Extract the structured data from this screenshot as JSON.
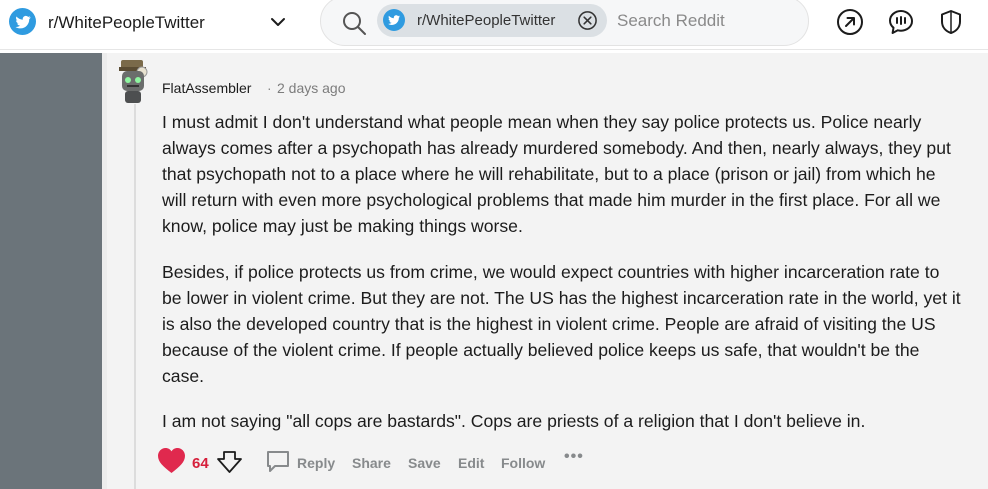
{
  "header": {
    "subreddit_name": "r/WhitePeopleTwitter",
    "subreddit_icon": "subreddit-bird-icon",
    "search_chip_label": "r/WhitePeopleTwitter",
    "search_placeholder": "Search Reddit"
  },
  "comment": {
    "author": "FlatAssembler",
    "separator": "·",
    "timestamp": "2 days ago",
    "paragraphs": [
      "I must admit I don't understand what people mean when they say police protects us. Police nearly always comes after a psychopath has already murdered somebody. And then, nearly always, they put that psychopath not to a place where he will rehabilitate, but to a place (prison or jail) from which he will return with even more psychological problems that made him murder in the first place. For all we know, police may just be making things worse.",
      "Besides, if police protects us from crime, we would expect countries with higher incarceration rate to be lower in violent crime. But they are not. The US has the highest incarceration rate in the world, yet it is also the developed country that is the highest in violent crime. People are afraid of visiting the US because of the violent crime. If people actually believed police keeps us safe, that wouldn't be the case.",
      "I am not saying \"all cops are bastards\". Cops are priests of a religion that I don't believe in."
    ],
    "score": "64",
    "actions": {
      "reply": "Reply",
      "share": "Share",
      "save": "Save",
      "edit": "Edit",
      "follow": "Follow",
      "more": "•••"
    }
  },
  "colors": {
    "accent_blue": "#2f9be0",
    "upvote_red": "#d61f3b",
    "sidebar_gray": "#6b747a",
    "comment_bg": "#f3f3f3"
  }
}
